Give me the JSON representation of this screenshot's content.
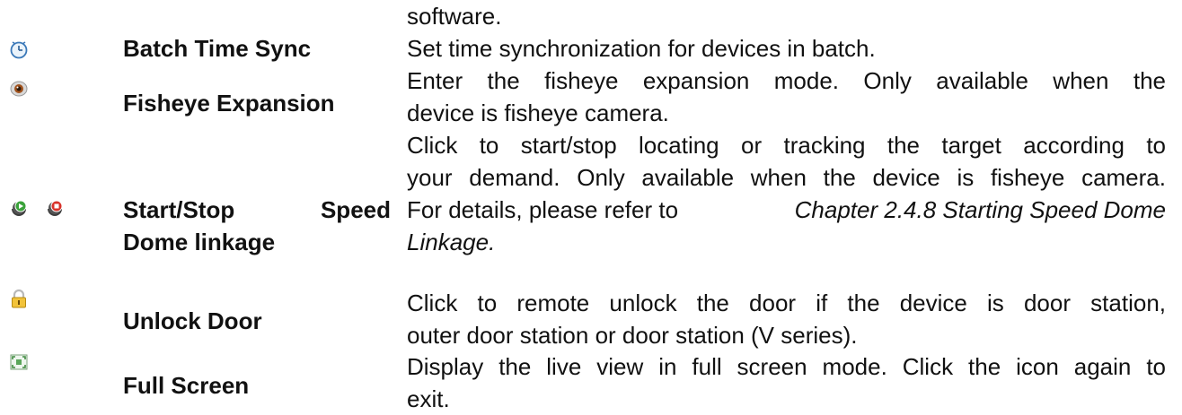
{
  "intro_tail": "software.",
  "rows": [
    {
      "icon_names": [
        "clock-icon"
      ],
      "name": "Batch Time Sync",
      "description_lines": [
        "Set time synchronization for devices in batch."
      ]
    },
    {
      "icon_names": [
        "fisheye-camera-icon"
      ],
      "name": "Fisheye Expansion",
      "description_lines": [
        "Enter the fisheye expansion mode. Only available when the",
        "device is fisheye camera."
      ]
    },
    {
      "icon_names": [
        "start-linkage-icon",
        "stop-linkage-icon"
      ],
      "name_line1_a": "Start/Stop",
      "name_line1_b": "Speed",
      "name_line2": "Dome linkage",
      "description_lines": [
        "Click to start/stop locating or tracking the target according to",
        "your demand. Only available when the device is fisheye camera.",
        "For details, please refer to"
      ],
      "reference_line3": "Chapter 2.4.8 Starting Speed Dome",
      "reference_line4": "Linkage."
    },
    {
      "icon_names": [
        "padlock-icon"
      ],
      "name": "Unlock Door",
      "description_lines": [
        "Click to remote unlock the door if the device is door station,",
        "outer door station or door station (V series)."
      ]
    },
    {
      "icon_names": [
        "full-screen-icon"
      ],
      "name": "Full Screen",
      "description_lines": [
        "Display the live view in full screen mode. Click the icon again to",
        "exit."
      ]
    }
  ]
}
